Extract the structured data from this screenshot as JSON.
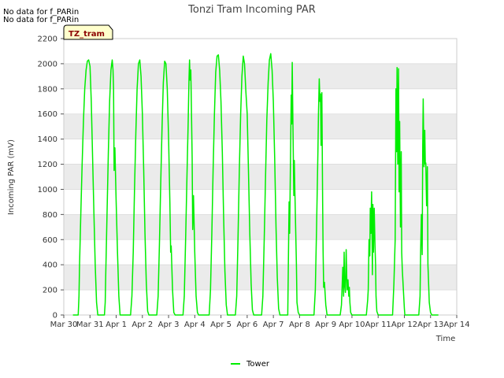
{
  "notes": [
    "No data for f_PARin",
    "No data for f_PARin"
  ],
  "site_badge": "TZ_tram",
  "chart_data": {
    "type": "line",
    "title": "Tonzi Tram Incoming PAR",
    "xlabel": "Time",
    "ylabel": "Incoming PAR (mV)",
    "ylim": [
      0,
      2200
    ],
    "yticks": [
      0,
      200,
      400,
      600,
      800,
      1000,
      1200,
      1400,
      1600,
      1800,
      2000,
      2200
    ],
    "xlim": [
      0,
      15
    ],
    "xtick_labels": [
      "Mar 30",
      "Mar 31",
      "Apr 1",
      "Apr 2",
      "Apr 3",
      "Apr 4",
      "Apr 5",
      "Apr 6",
      "Apr 7",
      "Apr 8",
      "Apr 9",
      "Apr 10",
      "Apr 11",
      "Apr 12",
      "Apr 13",
      "Apr 14"
    ],
    "x_units": "days since Mar 30",
    "grid": true,
    "band_color": "#ebebeb",
    "legend": "bottom-center",
    "series": [
      {
        "name": "Tower",
        "color": "#00ee00",
        "x": [
          0.35,
          0.55,
          0.58,
          0.6,
          0.65,
          0.7,
          0.75,
          0.8,
          0.85,
          0.9,
          0.95,
          1.0,
          1.05,
          1.1,
          1.15,
          1.2,
          1.25,
          1.3,
          1.55,
          1.58,
          1.6,
          1.65,
          1.7,
          1.75,
          1.8,
          1.85,
          1.88,
          1.9,
          1.92,
          1.95,
          2.0,
          2.05,
          2.1,
          2.15,
          2.2,
          2.25,
          2.3,
          2.55,
          2.6,
          2.65,
          2.7,
          2.75,
          2.8,
          2.85,
          2.9,
          2.95,
          3.0,
          3.05,
          3.1,
          3.15,
          3.2,
          3.25,
          3.3,
          3.55,
          3.6,
          3.65,
          3.7,
          3.75,
          3.8,
          3.85,
          3.9,
          3.95,
          4.0,
          4.05,
          4.08,
          4.1,
          4.15,
          4.2,
          4.25,
          4.3,
          4.55,
          4.6,
          4.65,
          4.7,
          4.75,
          4.78,
          4.8,
          4.82,
          4.85,
          4.88,
          4.9,
          4.92,
          4.95,
          5.0,
          5.05,
          5.1,
          5.15,
          5.2,
          5.25,
          5.3,
          5.55,
          5.6,
          5.65,
          5.7,
          5.75,
          5.8,
          5.85,
          5.9,
          5.95,
          6.0,
          6.05,
          6.1,
          6.15,
          6.2,
          6.25,
          6.3,
          6.55,
          6.6,
          6.65,
          6.7,
          6.75,
          6.8,
          6.85,
          6.9,
          6.95,
          7.0,
          7.05,
          7.1,
          7.15,
          7.2,
          7.25,
          7.3,
          7.55,
          7.6,
          7.65,
          7.7,
          7.75,
          7.8,
          7.85,
          7.9,
          7.95,
          8.0,
          8.05,
          8.1,
          8.15,
          8.2,
          8.25,
          8.3,
          8.55,
          8.6,
          8.62,
          8.65,
          8.68,
          8.7,
          8.72,
          8.75,
          8.78,
          8.8,
          8.82,
          8.85,
          8.88,
          8.9,
          8.95,
          9.0,
          9.05,
          9.1,
          9.15,
          9.2,
          9.25,
          9.3,
          9.55,
          9.6,
          9.65,
          9.7,
          9.72,
          9.75,
          9.78,
          9.8,
          9.82,
          9.85,
          9.88,
          9.9,
          9.92,
          9.95,
          10.0,
          10.05,
          10.1,
          10.15,
          10.2,
          10.25,
          10.3,
          10.55,
          10.6,
          10.62,
          10.65,
          10.68,
          10.7,
          10.72,
          10.75,
          10.78,
          10.8,
          10.82,
          10.85,
          10.88,
          10.9,
          10.92,
          10.95,
          11.0,
          11.05,
          11.1,
          11.15,
          11.2,
          11.25,
          11.3,
          11.55,
          11.6,
          11.62,
          11.65,
          11.68,
          11.7,
          11.72,
          11.75,
          11.78,
          11.8,
          11.82,
          11.85,
          11.88,
          11.9,
          11.92,
          11.95,
          12.0,
          12.02,
          12.05,
          12.08,
          12.1,
          12.15,
          12.2,
          12.25,
          12.3,
          12.55,
          12.6,
          12.65,
          12.68,
          12.7,
          12.72,
          12.75,
          12.78,
          12.8,
          12.82,
          12.85,
          12.88,
          12.9,
          12.92,
          12.95,
          13.0,
          13.02,
          13.05,
          13.08,
          13.1,
          13.15,
          13.2,
          13.25,
          13.3,
          13.55,
          13.6,
          13.62,
          13.65,
          13.68,
          13.7,
          13.72,
          13.75,
          13.78,
          13.8,
          13.82,
          13.85,
          13.88,
          13.9,
          13.92,
          13.95,
          14.0,
          14.05,
          14.1,
          14.15,
          14.2,
          14.25,
          14.3
        ],
        "y": [
          0,
          0,
          150,
          400,
          800,
          1200,
          1550,
          1800,
          1950,
          2020,
          2030,
          1980,
          1700,
          1250,
          800,
          400,
          100,
          0,
          0,
          100,
          300,
          800,
          1300,
          1700,
          1950,
          2030,
          1950,
          1800,
          1150,
          1330,
          900,
          500,
          150,
          0,
          0,
          0,
          0,
          0,
          150,
          500,
          1000,
          1450,
          1800,
          2000,
          2030,
          1900,
          1600,
          1150,
          650,
          250,
          30,
          0,
          0,
          0,
          150,
          550,
          1050,
          1500,
          1850,
          2020,
          2000,
          1800,
          1400,
          900,
          500,
          550,
          200,
          20,
          0,
          0,
          0,
          150,
          600,
          1100,
          1550,
          1880,
          2030,
          1870,
          1950,
          1550,
          1250,
          680,
          950,
          500,
          150,
          20,
          0,
          0,
          0,
          0,
          0,
          200,
          650,
          1150,
          1600,
          1930,
          2060,
          2070,
          1950,
          1700,
          1300,
          800,
          350,
          80,
          0,
          0,
          0,
          150,
          600,
          1150,
          1600,
          1900,
          2060,
          2000,
          1780,
          1600,
          1150,
          650,
          250,
          40,
          0,
          0,
          0,
          150,
          600,
          1100,
          1550,
          1850,
          2030,
          2080,
          1950,
          1700,
          1250,
          700,
          300,
          50,
          0,
          0,
          0,
          900,
          650,
          1200,
          1750,
          1520,
          2010,
          1450,
          950,
          1230,
          1000,
          700,
          400,
          100,
          20,
          0,
          0,
          0,
          0,
          0,
          0,
          0,
          0,
          200,
          700,
          1300,
          1600,
          1880,
          1700,
          1760,
          1350,
          1770,
          900,
          500,
          220,
          260,
          80,
          0,
          0,
          0,
          0,
          0,
          0,
          0,
          80,
          200,
          380,
          150,
          500,
          250,
          180,
          520,
          300,
          200,
          280,
          150,
          220,
          100,
          20,
          0,
          0,
          0,
          0,
          0,
          0,
          0,
          0,
          120,
          200,
          600,
          470,
          850,
          650,
          980,
          320,
          880,
          500,
          850,
          550,
          400,
          150,
          30,
          0,
          0,
          0,
          0,
          0,
          0,
          0,
          0,
          0,
          0,
          250,
          600,
          1800,
          1300,
          1970,
          1200,
          1960,
          980,
          1540,
          700,
          1300,
          500,
          370,
          250,
          50,
          0,
          0,
          0,
          0,
          0,
          0,
          0,
          0,
          0,
          150,
          500,
          800,
          480,
          1350,
          1720,
          1180,
          1470,
          1200,
          1210,
          870,
          1180,
          400,
          280,
          100,
          20,
          0,
          0,
          0,
          0,
          0,
          0
        ]
      }
    ]
  }
}
